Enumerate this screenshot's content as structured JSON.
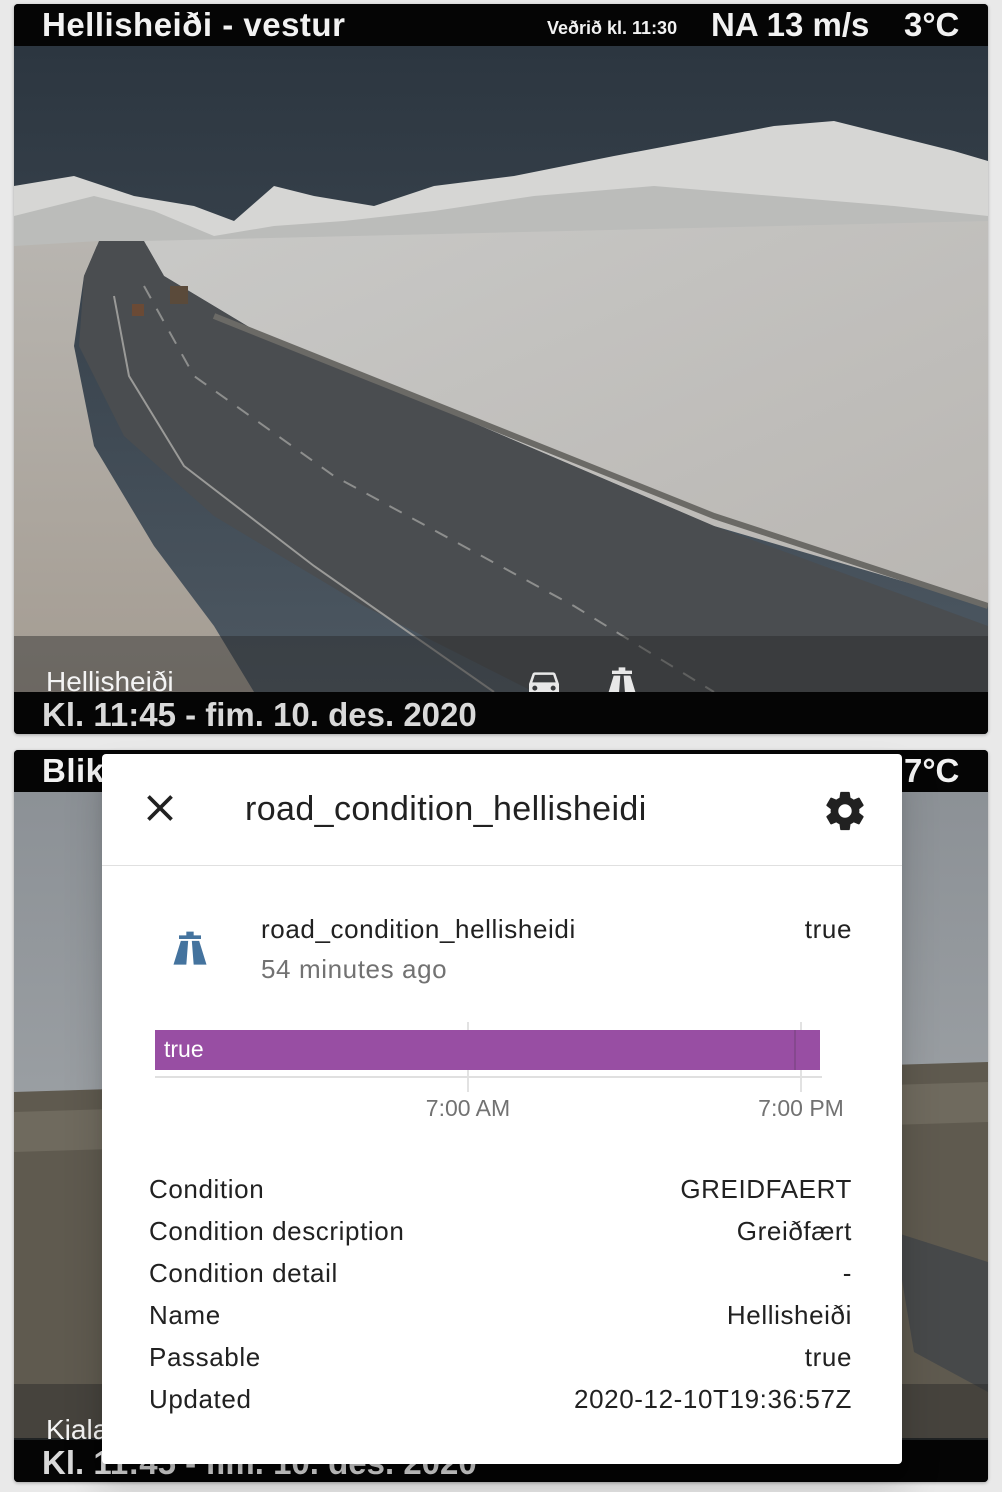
{
  "camera1": {
    "title": "Hellisheiði - vestur",
    "weather_time": "Veðrið kl. 11:30",
    "wind": "NA 13 m/s",
    "temp": "3°C",
    "location_label": "Hellisheiði",
    "timestamp": "Kl. 11:45 - fim. 10. des. 2020"
  },
  "camera2": {
    "title_partial": "Blik",
    "temp_partial": "7°C",
    "location_partial": "Kjala",
    "timestamp": "Kl. 11:45 - fim. 10. des. 2020"
  },
  "icons": {
    "car": "car-icon",
    "road": "highway-icon",
    "close": "close-icon",
    "settings": "gear-icon"
  },
  "dialog": {
    "title": "road_condition_hellisheidi",
    "entity_name": "road_condition_hellisheidi",
    "last_changed": "54 minutes ago",
    "state": "true",
    "timeline": {
      "bar_label": "true",
      "bar_color": "#984ea3",
      "start_fraction": 0.0,
      "end_fraction": 1.0,
      "ticks": [
        "7:00 AM",
        "7:00 PM"
      ]
    },
    "attributes": [
      {
        "label": "Condition",
        "value": "GREIDFAERT"
      },
      {
        "label": "Condition description",
        "value": "Greiðfært"
      },
      {
        "label": "Condition detail",
        "value": "-"
      },
      {
        "label": "Name",
        "value": "Hellisheiði"
      },
      {
        "label": "Passable",
        "value": "true"
      },
      {
        "label": "Updated",
        "value": "2020-12-10T19:36:57Z"
      }
    ]
  },
  "colors": {
    "icon_blue": "#44739e",
    "text_primary": "#212121",
    "text_secondary": "#727272"
  }
}
